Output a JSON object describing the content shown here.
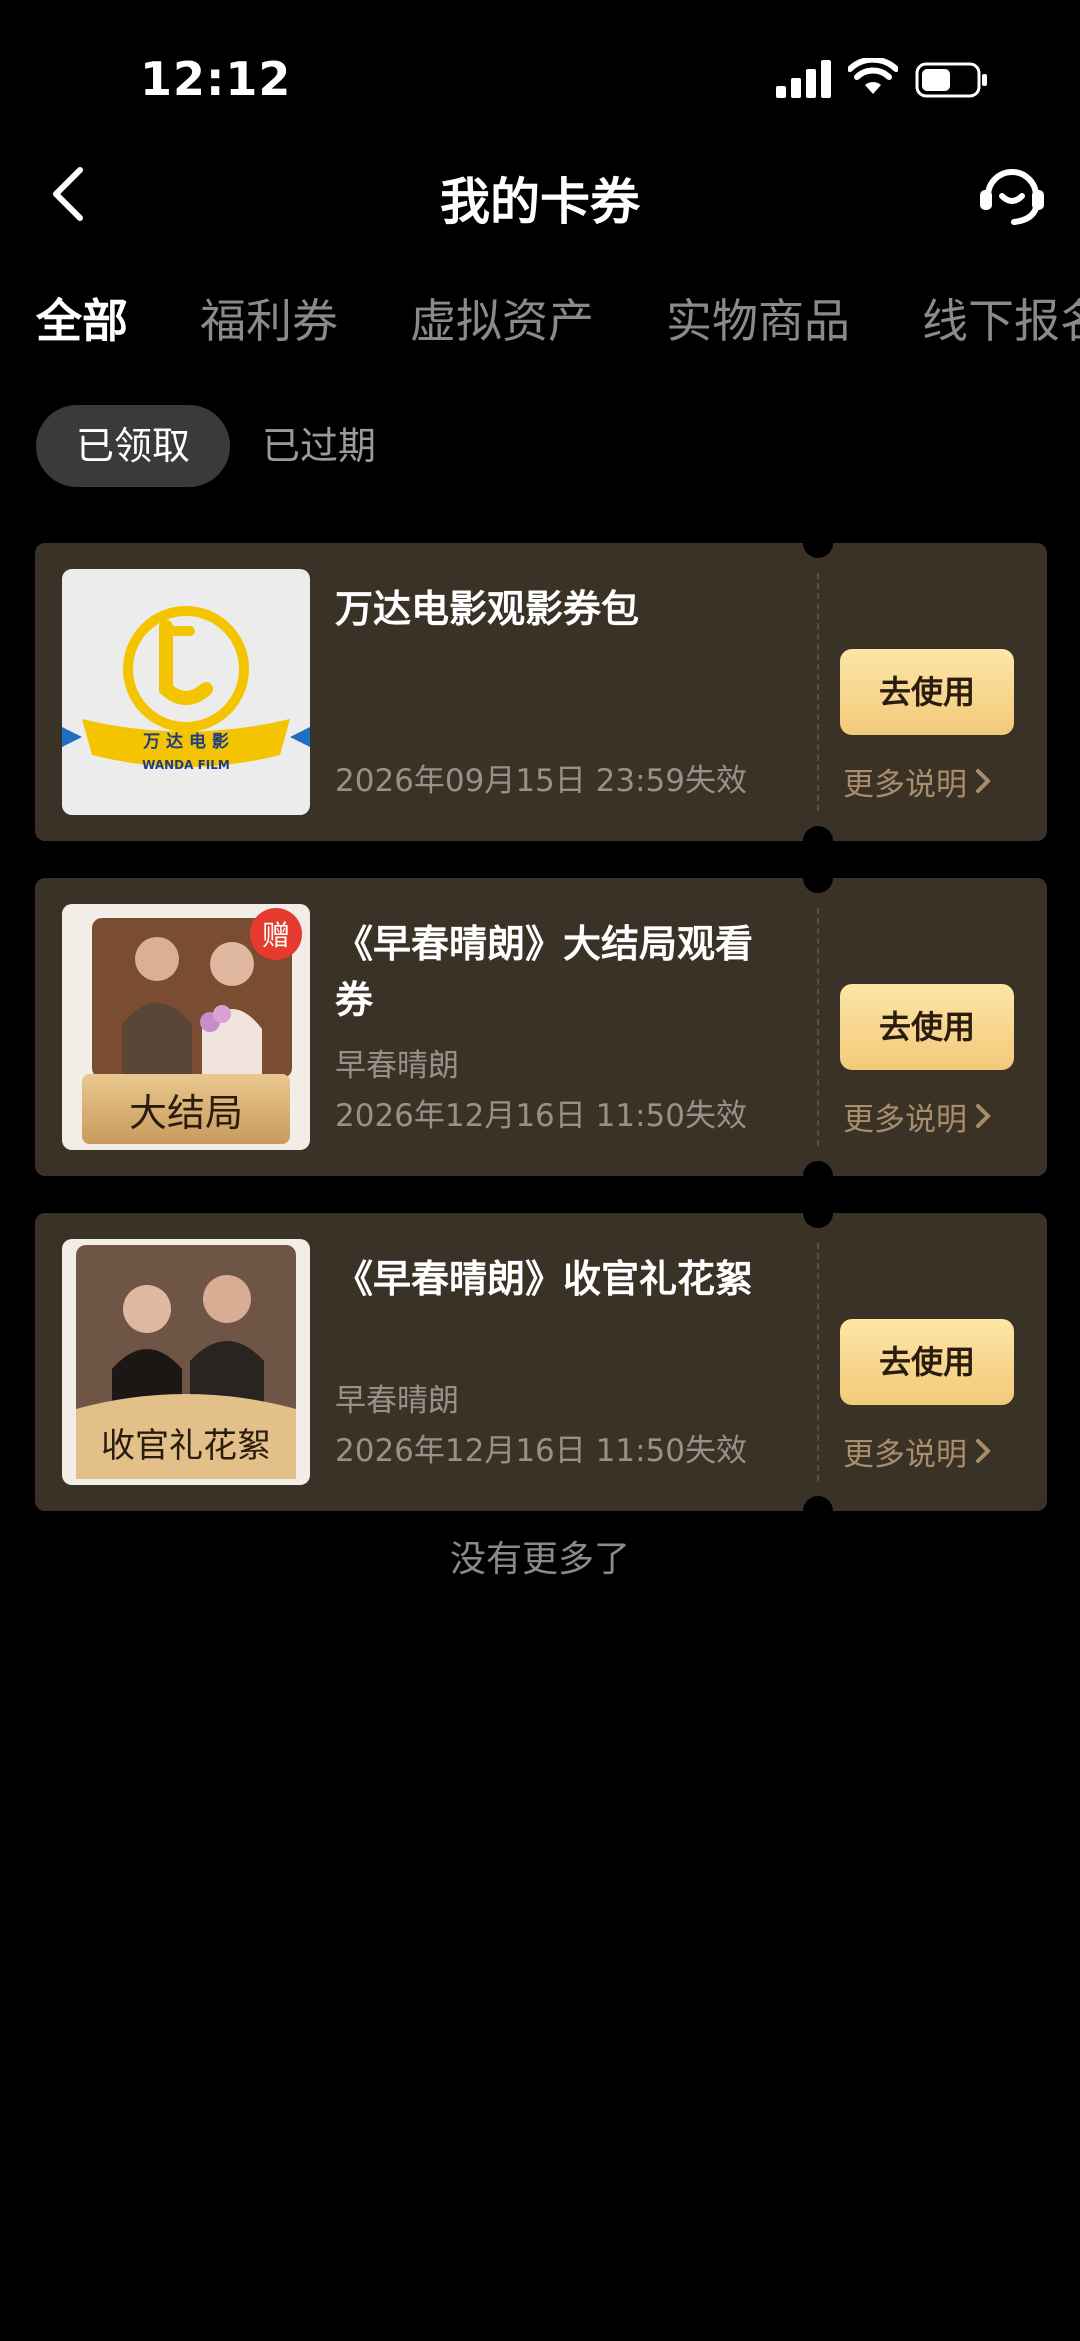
{
  "status": {
    "time": "12:12"
  },
  "header": {
    "title": "我的卡券"
  },
  "tabs": [
    {
      "label": "全部"
    },
    {
      "label": "福利券"
    },
    {
      "label": "虚拟资产"
    },
    {
      "label": "实物商品"
    },
    {
      "label": "线下报名"
    }
  ],
  "filters": [
    {
      "label": "已领取"
    },
    {
      "label": "已过期"
    }
  ],
  "cards": [
    {
      "title": "万达电影观影券包",
      "subtitle": "",
      "expire": "2026年09月15日 23:59失效",
      "use": "去使用",
      "more": "更多说明",
      "thumb_text": "万 达 电 影",
      "thumb_sub": "WANDA FILM"
    },
    {
      "title": "《早春晴朗》大结局观看券",
      "subtitle": "早春晴朗",
      "expire": "2026年12月16日 11:50失效",
      "use": "去使用",
      "more": "更多说明",
      "thumb_text": "大结局",
      "badge": "赠"
    },
    {
      "title": "《早春晴朗》收官礼花絮",
      "subtitle": "早春晴朗",
      "expire": "2026年12月16日 11:50失效",
      "use": "去使用",
      "more": "更多说明",
      "thumb_text": "收官礼花絮"
    }
  ],
  "footer": {
    "no_more": "没有更多了"
  },
  "colors": {
    "accent": "#f2c97a",
    "card_bg": "#3a3127"
  }
}
